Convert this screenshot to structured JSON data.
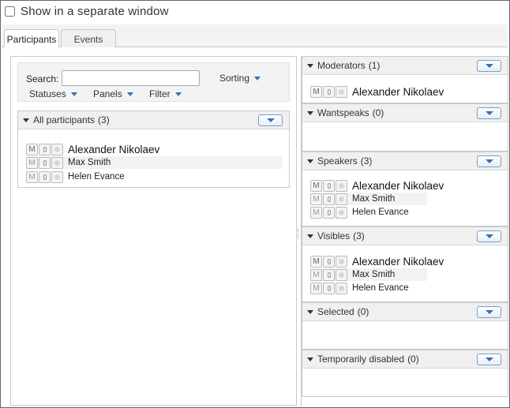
{
  "window": {
    "separate_window_label": "Show in a separate window"
  },
  "tabs": [
    {
      "label": "Participants",
      "active": true
    },
    {
      "label": "Events",
      "active": false
    }
  ],
  "search": {
    "label": "Search:",
    "value": "",
    "placeholder": ""
  },
  "toolbar": {
    "sorting": "Sorting",
    "statuses": "Statuses",
    "panels": "Panels",
    "filter": "Filter"
  },
  "badge_labels": {
    "moderator": "M"
  },
  "all_participants": {
    "title": "All participants",
    "count": "(3)",
    "rows": [
      "Alexander Nikolaev",
      "Max Smith",
      "Helen Evance"
    ]
  },
  "groups": {
    "moderators": {
      "title": "Moderators",
      "count": "(1)",
      "rows": [
        "Alexander Nikolaev"
      ]
    },
    "wantspeaks": {
      "title": "Wantspeaks",
      "count": "(0)",
      "rows": []
    },
    "speakers": {
      "title": "Speakers",
      "count": "(3)",
      "rows": [
        "Alexander Nikolaev",
        "Max Smith",
        "Helen Evance"
      ]
    },
    "visibles": {
      "title": "Visibles",
      "count": "(3)",
      "rows": [
        "Alexander Nikolaev",
        "Max Smith",
        "Helen Evance"
      ]
    },
    "selected": {
      "title": "Selected",
      "count": "(0)",
      "rows": []
    },
    "temporarily_disabled": {
      "title": "Temporarily disabled",
      "count": "(0)",
      "rows": []
    }
  },
  "colors": {
    "accent": "#3a6fa9",
    "header_bg": "#f0f0f0",
    "border": "#c9c9c9"
  }
}
